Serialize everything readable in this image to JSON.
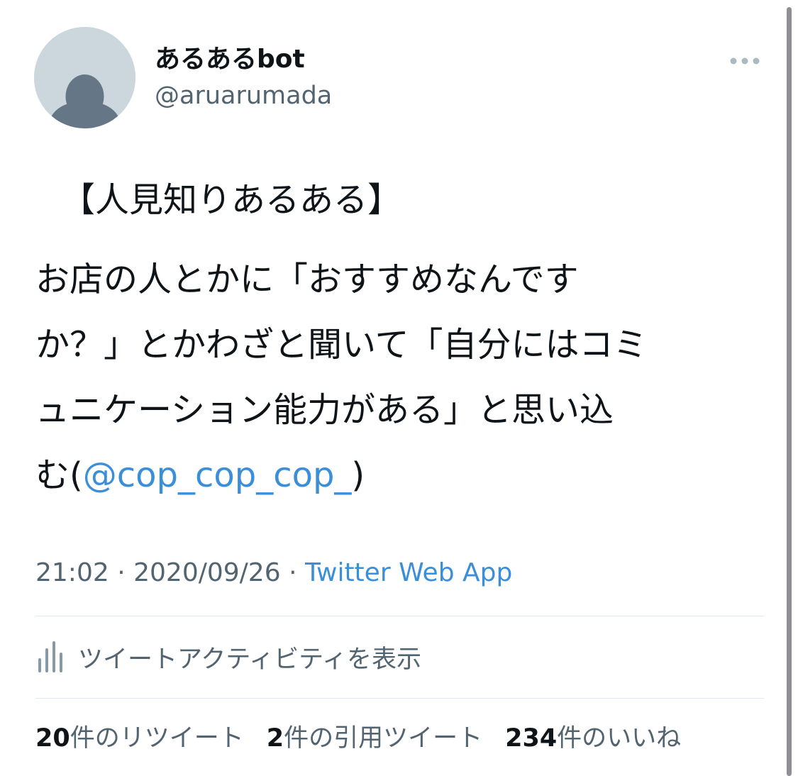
{
  "author": {
    "display_name": "あるあるbot",
    "handle": "@aruarumada",
    "avatar_icon": "default-profile-icon"
  },
  "more_icon": "more-horizontal-icon",
  "tweet": {
    "heading": "【人見知りあるある】",
    "lines": [
      "お店の人とかに「おすすめなんです",
      "か？」とかわざと聞いて「自分にはコミ",
      "ュニケーション能力がある」と思い込"
    ],
    "last_line_prefix": "む(",
    "mention": "@cop_cop_cop_",
    "last_line_suffix": ")"
  },
  "meta": {
    "time": "21:02",
    "separator": "·",
    "date": "2020/09/26",
    "source": "Twitter Web App"
  },
  "activity": {
    "icon": "analytics-icon",
    "label": "ツイートアクティビティを表示"
  },
  "stats": {
    "retweets": {
      "count": "20",
      "label": "件のリツイート"
    },
    "quotes": {
      "count": "2",
      "label": "件の引用ツイート"
    },
    "likes": {
      "count": "234",
      "label": "件のいいね"
    }
  },
  "colors": {
    "link": "#3b8ed8",
    "secondary_text": "#536471",
    "primary_text": "#0f1419",
    "avatar_bg": "#ccd6dd",
    "avatar_fg": "#657786"
  }
}
